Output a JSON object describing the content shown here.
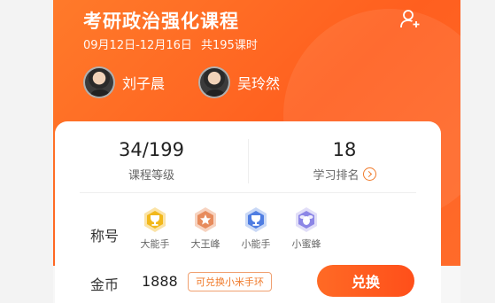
{
  "course": {
    "title": "考研政治强化课程",
    "date_range": "09月12日-12月16日",
    "total_lessons": "共195课时"
  },
  "teachers": [
    {
      "name": "刘子晨"
    },
    {
      "name": "吴玲然"
    }
  ],
  "stats": {
    "level_value": "34/199",
    "level_label": "课程等级",
    "rank_value": "18",
    "rank_label": "学习排名"
  },
  "titles": {
    "label": "称号",
    "badges": [
      {
        "name": "大能手",
        "icon": "gold-trophy-icon",
        "color": "#f2b81b"
      },
      {
        "name": "大王峰",
        "icon": "bronze-star-icon",
        "color": "#e78b5c"
      },
      {
        "name": "小能手",
        "icon": "blue-trophy-icon",
        "color": "#4f7de2"
      },
      {
        "name": "小蜜蜂",
        "icon": "purple-bee-icon",
        "color": "#8c86e6"
      }
    ]
  },
  "coins": {
    "label": "金币",
    "value": "1888",
    "tag": "可兑换小米手环",
    "redeem_button": "兑换"
  },
  "colors": {
    "header_orange": "#ff5f1f",
    "accent": "#f07a2a"
  }
}
